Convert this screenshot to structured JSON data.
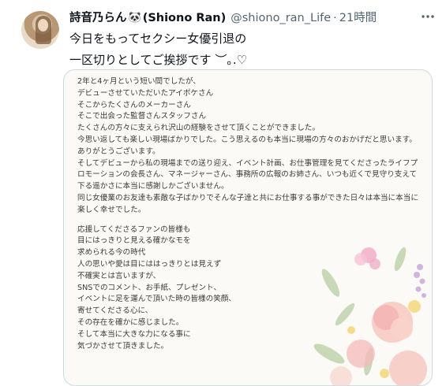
{
  "tweet": {
    "display_name": "詩音乃らん",
    "panda_emoji": "🐼",
    "name_suffix": "(Shiono Ran)",
    "handle": "@shiono_ran_Life",
    "separator": "·",
    "time": "21時間",
    "text_line1": "今日をもってセクシー女優引退の",
    "text_line2": "一区切りとしてご挨拶です ︶｡.♡"
  },
  "letter": {
    "paragraph1": [
      "2年と4ヶ月という短い間でしたが、",
      "デビューさせていただいたアイポケさん",
      "そこからたくさんのメーカーさん",
      "そこで出会った監督さんスタッフさん",
      "たくさんの方々に支えられ沢山の経験をさせて頂くことができました。",
      "今思い返しても楽しい現場ばかりでした。こう思えるのも本当に現場の方々のおかげだと思います。",
      "ありがとうございます。",
      "そしてデビューから私の現場までの送り迎え、イベント計画、お仕事管理を見てくださったライフプロモーションの会長さん、マネージャーさん、事務所の広報のお姉さん、いつも近くで見守り支えて下る遥かさに本当に感謝しかございません。",
      "同じ女優業のお友達も素敵な子ばかりでそんな子達と共にお仕事する事ができた日々は本当に本当に楽しく幸せでした。"
    ],
    "paragraph2": [
      "応援してくださるファンの皆様も",
      "目にはっきりと見える確かなモを",
      "求められる今の時代",
      "人の思いや愛は目にははっきりとは見えず",
      "不確実とは言いますが、",
      "SNSでのコメント、お手紙、プレゼント、",
      "イベントに足を運んで頂いた時の皆様の笑顔、",
      "寄せてくださる心に、",
      "その存在を確かに感じました。",
      "そして本当に大きな力になる事に",
      "気づかさせて頂きました。"
    ]
  },
  "icons": {
    "more": "more-icon"
  }
}
